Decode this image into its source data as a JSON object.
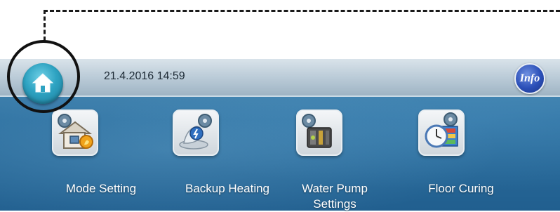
{
  "status_bar": {
    "datetime": "21.4.2016 14:59",
    "info_label": "Info"
  },
  "icons": {
    "home": "home-icon",
    "info": "info-icon"
  },
  "tiles": [
    {
      "label": "Mode Setting",
      "icon": "mode-setting-icon"
    },
    {
      "label": "Backup Heating",
      "icon": "backup-heating-icon"
    },
    {
      "label": "Water Pump",
      "label2": "Settings",
      "icon": "water-pump-icon"
    },
    {
      "label": "Floor Curing",
      "icon": "floor-curing-icon"
    }
  ],
  "colors": {
    "accent": "#2ea3c2",
    "background": "#2c6f9f",
    "info": "#2b4fb8"
  }
}
